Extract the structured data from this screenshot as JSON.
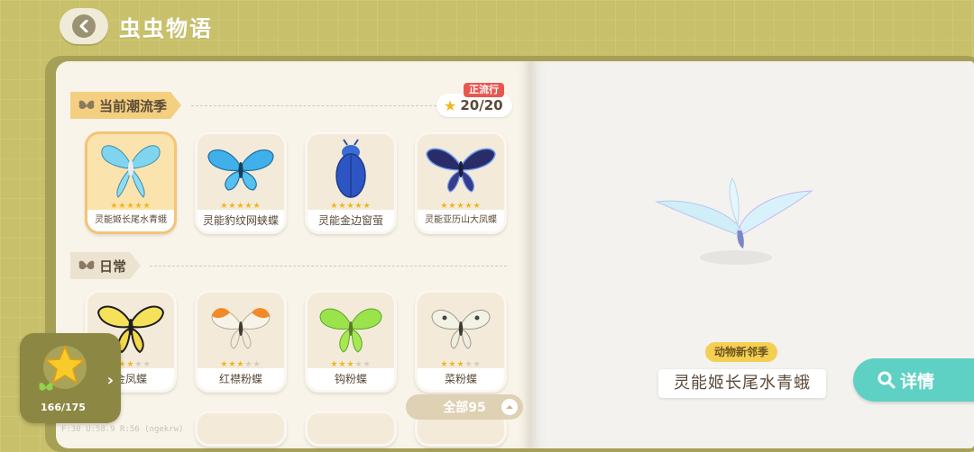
{
  "header": {
    "title": "虫虫物语"
  },
  "sections": {
    "current": {
      "label": "当前潮流季",
      "badge": "正流行",
      "count": "20/20"
    },
    "daily": {
      "label": "日常"
    }
  },
  "current_cards": [
    {
      "name": "灵能姬长尾水青蛾",
      "stars": 5
    },
    {
      "name": "灵能豹纹网蛱蝶",
      "stars": 5
    },
    {
      "name": "灵能金边窗萤",
      "stars": 5
    },
    {
      "name": "灵能亚历山大凤蝶",
      "stars": 5
    }
  ],
  "daily_cards": [
    {
      "name": "金凤蝶",
      "stars": 3
    },
    {
      "name": "红襟粉蝶",
      "stars": 3
    },
    {
      "name": "钩粉蝶",
      "stars": 3
    },
    {
      "name": "菜粉蝶",
      "stars": 3
    }
  ],
  "all_filter": {
    "label": "全部95"
  },
  "progress": {
    "count": "166/175"
  },
  "debug": "F:30  U:58.9  R:56  (ngekrw)",
  "detail": {
    "season": "动物新邻季",
    "name": "灵能姬长尾水青蛾",
    "button": "详情"
  },
  "colors": {
    "accent": "#5fd1c4",
    "star": "#f1b61b",
    "tag": "#f3cf7f"
  }
}
